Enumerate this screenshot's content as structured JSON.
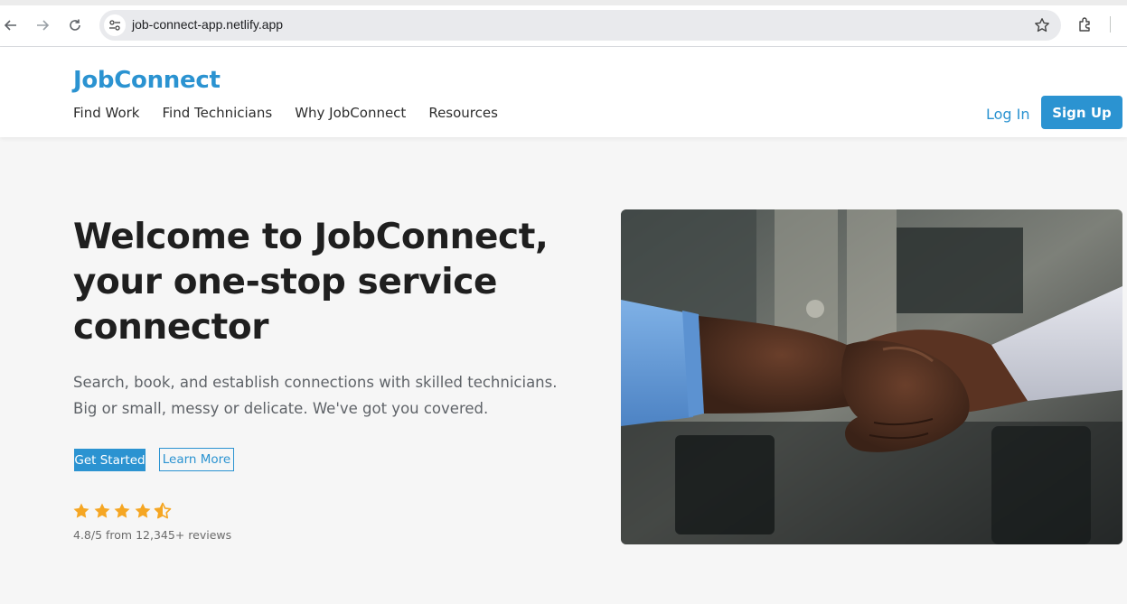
{
  "browser": {
    "url": "job-connect-app.netlify.app",
    "icons": [
      "back-arrow-icon",
      "forward-arrow-icon",
      "reload-icon",
      "site-info-icon",
      "bookmark-star-icon",
      "extensions-icon"
    ]
  },
  "header": {
    "logo": "JobConnect",
    "nav": [
      "Find Work",
      "Find Technicians",
      "Why JobConnect",
      "Resources"
    ],
    "login_label": "Log In",
    "signup_label": "Sign Up"
  },
  "hero": {
    "title": "Welcome to JobConnect, your one-stop service connector",
    "subtitle": "Search, book, and establish connections with skilled technicians. Big or small, messy or delicate. We've got you covered.",
    "primary_cta": "Get Started",
    "secondary_cta": "Learn More",
    "rating": {
      "stars": 4.5,
      "max": 5,
      "text": "4.8/5 from 12,345+ reviews"
    },
    "image_subject": "handshake-photo"
  },
  "colors": {
    "brand": "#2b93d1",
    "star": "#f5a623",
    "page_bg": "#f6f6f6",
    "text": "#1f1f1f"
  }
}
